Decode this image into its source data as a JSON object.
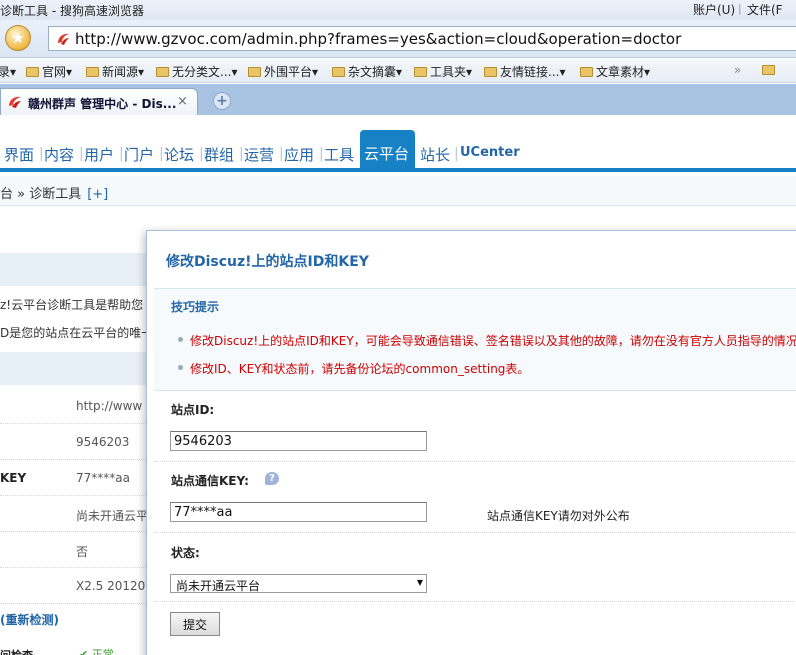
{
  "browser": {
    "window_title": "诊断工具 - 搜狗高速浏览器",
    "menu_account": "账户(U)",
    "menu_file": "文件(F",
    "url": "http://www.gzvoc.com/admin.php?frames=yes&action=cloud&operation=doctor",
    "bookmarks": [
      "录▾",
      "官网▾",
      "新闻源▾",
      "无分类文...▾",
      "外围平台▾",
      "杂文摘囊▾",
      "工具夹▾",
      "友情链接...▾",
      "文章素材▾"
    ],
    "bookmarks_more": "»",
    "tab_label": "赣州群声 管理中心 - Dis...",
    "tab_close": "×",
    "new_tab": "+"
  },
  "nav": {
    "items": [
      "界面",
      "内容",
      "用户",
      "门户",
      "论坛",
      "群组",
      "运营",
      "应用",
      "工具"
    ],
    "active": "云平台",
    "after": [
      "站长",
      "UCenter"
    ]
  },
  "breadcrumb": {
    "text": "台 » 诊断工具",
    "plus": "[+]"
  },
  "background": {
    "desc1": "z!云平台诊断工具是帮助您",
    "desc2": "D是您的站点在云平台的唯一",
    "rows": [
      {
        "key": "",
        "value": "http://www"
      },
      {
        "key": "",
        "value": "9546203"
      },
      {
        "key": "KEY",
        "value": "77****aa"
      },
      {
        "key": "",
        "value": "尚未开通云平"
      },
      {
        "key": "",
        "value": "否"
      },
      {
        "key": "",
        "value": "X2.5 20120"
      }
    ],
    "recheck": "(重新检测)",
    "bottom_label": "问检查",
    "bottom_status": "✔ 正常"
  },
  "dialog": {
    "title": "修改Discuz!上的站点ID和KEY",
    "tips_title": "技巧提示",
    "tips": [
      "修改Discuz!上的站点ID和KEY，可能会导致通信错误、签名错误以及其他的故障，请勿在没有官方人员指导的情况",
      "修改ID、KEY和状态前，请先备份论坛的common_setting表。"
    ],
    "site_id_label": "站点ID:",
    "site_id_value": "9546203",
    "key_label": "站点通信KEY:",
    "key_help": "?",
    "key_value": "77****aa",
    "key_note": "站点通信KEY请勿对外公布",
    "status_label": "状态:",
    "status_value": "尚未开通云平台",
    "submit": "提交"
  }
}
